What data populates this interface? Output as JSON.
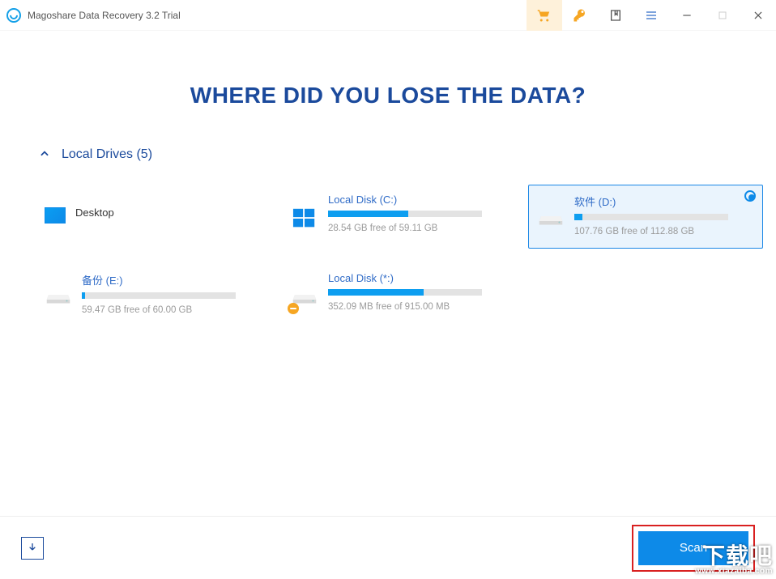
{
  "titlebar": {
    "app_title": "Magoshare Data Recovery 3.2 Trial"
  },
  "heading": "WHERE DID YOU LOSE THE DATA?",
  "section": {
    "title": "Local Drives (5)"
  },
  "drives": [
    {
      "name": "Desktop",
      "meta": "",
      "icon": "desktop",
      "fill": 0,
      "selected": false,
      "has_bar": false
    },
    {
      "name": "Local Disk (C:)",
      "meta": "28.54 GB free of 59.11 GB",
      "icon": "os",
      "fill": 52,
      "selected": false,
      "has_bar": true
    },
    {
      "name": "软件 (D:)",
      "meta": "107.76 GB free of 112.88 GB",
      "icon": "hdd",
      "fill": 5,
      "selected": true,
      "has_bar": true
    },
    {
      "name": "备份 (E:)",
      "meta": "59.47 GB free of 60.00 GB",
      "icon": "hdd",
      "fill": 2,
      "selected": false,
      "has_bar": true
    },
    {
      "name": "Local Disk (*:)",
      "meta": "352.09 MB free of 915.00 MB",
      "icon": "hdd-warn",
      "fill": 62,
      "selected": false,
      "has_bar": true
    }
  ],
  "footer": {
    "scan_label": "Scan"
  },
  "watermark": {
    "text_big": "下载吧",
    "text_small": "www.xiazaiba.com"
  }
}
